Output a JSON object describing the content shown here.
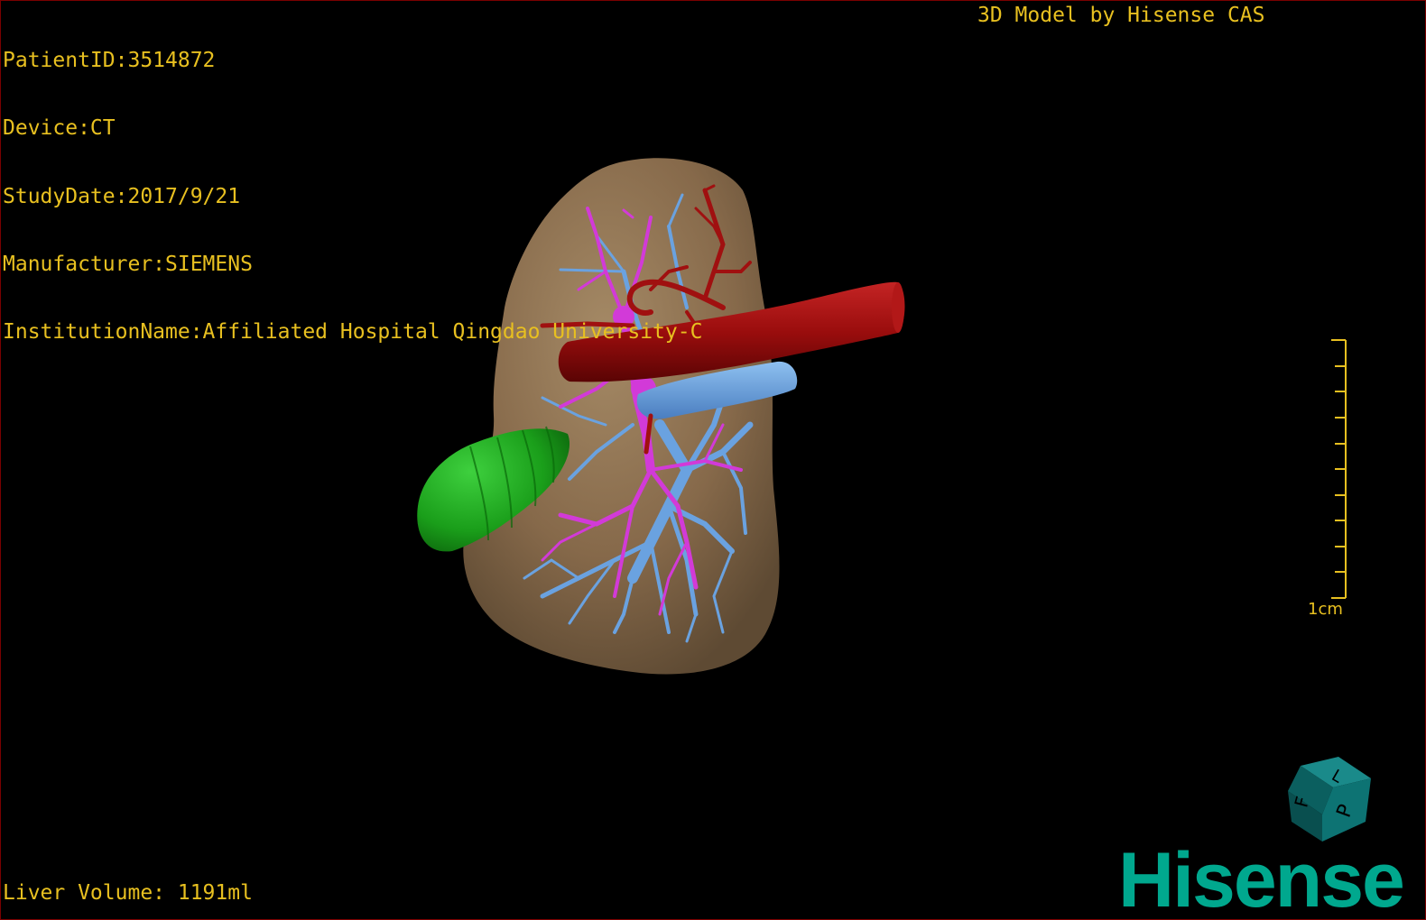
{
  "overlay": {
    "patient_id": "PatientID:3514872",
    "device": "Device:CT",
    "study_date": "StudyDate:2017/9/21",
    "manufacturer": "Manufacturer:SIEMENS",
    "institution": "InstitutionName:Affiliated Hospital Qingdao University-C",
    "title": "3D Model by Hisense CAS",
    "liver_volume": "Liver Volume: 1191ml"
  },
  "scale_bar": {
    "label": "1cm"
  },
  "orientation_cube": {
    "face_front": "P",
    "face_side": "F",
    "face_top": "L"
  },
  "logo": {
    "text": "Hisense"
  },
  "colors": {
    "overlay_text": "#e8c020",
    "liver": "#8a6e4c",
    "artery": "#9a0d0d",
    "portal_vein": "#6aa2e0",
    "hepatic_vein": "#d23ad8",
    "gallbladder": "#1a9e1a",
    "brand": "#00a88e",
    "cube": "#0d6e6e"
  },
  "icons": {
    "orientation_cube": "orientation-cube-icon",
    "scale_bar": "scale-bar-icon"
  }
}
